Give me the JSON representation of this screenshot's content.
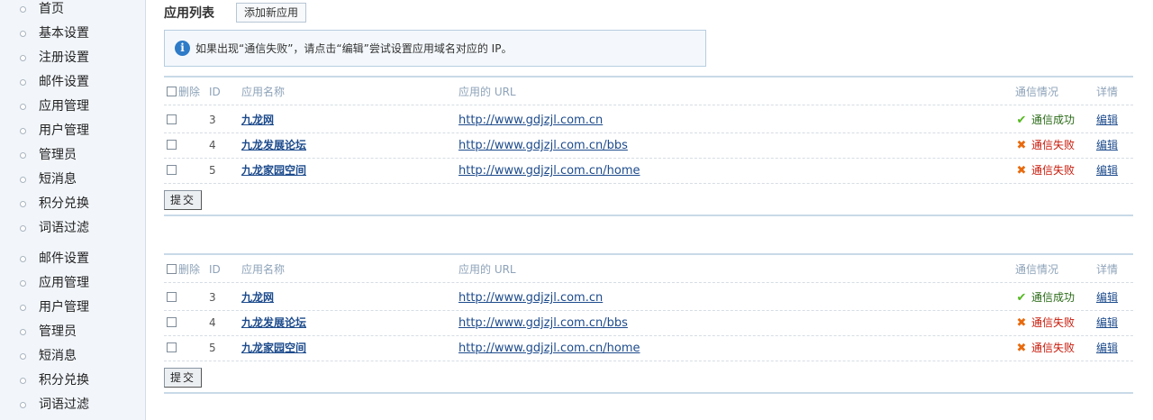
{
  "sidebar": {
    "group1": [
      "首页",
      "基本设置",
      "注册设置",
      "邮件设置",
      "应用管理",
      "用户管理",
      "管理员",
      "短消息",
      "积分兑换",
      "词语过滤"
    ],
    "group2": [
      "邮件设置",
      "应用管理",
      "用户管理",
      "管理员",
      "短消息",
      "积分兑换",
      "词语过滤"
    ]
  },
  "page": {
    "title": "应用列表",
    "add_button": "添加新应用",
    "notice": "如果出现“通信失败”，请点击“编辑”尝试设置应用域名对应的 IP。",
    "notice_icon": "info-icon"
  },
  "table_header": {
    "delete": "删除",
    "id": "ID",
    "name": "应用名称",
    "url": "应用的 URL",
    "status": "通信情况",
    "detail": "详情"
  },
  "tables": [
    {
      "rows": [
        {
          "id": "3",
          "name": "九龙网",
          "url": "http://www.gdjzjl.com.cn",
          "status": "通信成功",
          "status_type": "ok",
          "detail": "编辑"
        },
        {
          "id": "4",
          "name": "九龙发展论坛",
          "url": "http://www.gdjzjl.com.cn/bbs",
          "status": "通信失败",
          "status_type": "fail",
          "detail": "编辑"
        },
        {
          "id": "5",
          "name": "九龙家园空间",
          "url": "http://www.gdjzjl.com.cn/home",
          "status": "通信失败",
          "status_type": "fail",
          "detail": "编辑"
        }
      ],
      "submit": "提交"
    },
    {
      "rows": [
        {
          "id": "3",
          "name": "九龙网",
          "url": "http://www.gdjzjl.com.cn",
          "status": "通信成功",
          "status_type": "ok",
          "detail": "编辑"
        },
        {
          "id": "4",
          "name": "九龙发展论坛",
          "url": "http://www.gdjzjl.com.cn/bbs",
          "status": "通信失败",
          "status_type": "fail",
          "detail": "编辑"
        },
        {
          "id": "5",
          "name": "九龙家园空间",
          "url": "http://www.gdjzjl.com.cn/home",
          "status": "通信失败",
          "status_type": "fail",
          "detail": "编辑"
        }
      ],
      "submit": "提交"
    }
  ],
  "colors": {
    "link": "#1d4b8c",
    "success": "#2a6a17",
    "fail": "#c81a0a",
    "accent_border": "#c9dae8"
  }
}
